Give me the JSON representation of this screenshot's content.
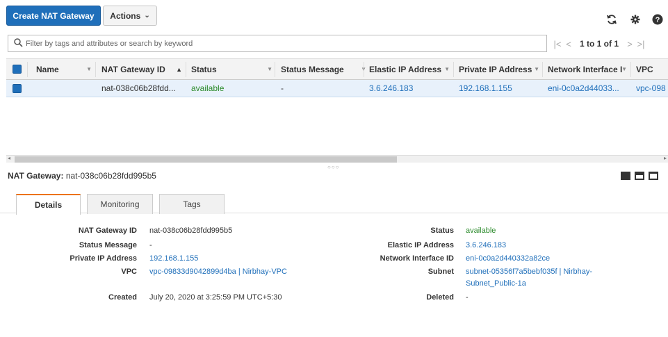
{
  "toolbar": {
    "create_label": "Create NAT Gateway",
    "actions_label": "Actions",
    "actions_chevron": "⌄"
  },
  "search": {
    "placeholder": "Filter by tags and attributes or search by keyword"
  },
  "pager": {
    "text": "1 to 1 of 1",
    "first": "|<",
    "prev": "<",
    "next": ">",
    "last": ">|"
  },
  "table": {
    "columns": [
      "Name",
      "NAT Gateway ID",
      "Status",
      "Status Message",
      "Elastic IP Address",
      "Private IP Address",
      "Network Interface I",
      "VPC"
    ],
    "rows": [
      {
        "name": "",
        "nat_gateway_id": "nat-038c06b28fdd...",
        "status": "available",
        "status_message": "-",
        "elastic_ip": "3.6.246.183",
        "private_ip": "192.168.1.155",
        "network_interface": "eni-0c0a2d44033...",
        "vpc": "vpc-098"
      }
    ]
  },
  "detail": {
    "title_label": "NAT Gateway:",
    "title_value": "nat-038c06b28fdd995b5",
    "tabs": [
      "Details",
      "Monitoring",
      "Tags"
    ],
    "left": [
      {
        "label": "NAT Gateway ID",
        "value": "nat-038c06b28fdd995b5"
      },
      {
        "label": "Status Message",
        "value": "-"
      },
      {
        "label": "Private IP Address",
        "value": "192.168.1.155"
      },
      {
        "label": "VPC",
        "value": "vpc-09833d9042899d4ba | Nirbhay-VPC"
      },
      {
        "label": "Created",
        "value": "July 20, 2020 at 3:25:59 PM UTC+5:30"
      }
    ],
    "right": [
      {
        "label": "Status",
        "value": "available"
      },
      {
        "label": "Elastic IP Address",
        "value": "3.6.246.183"
      },
      {
        "label": "Network Interface ID",
        "value": "eni-0c0a2d440332a82ce"
      },
      {
        "label": "Subnet",
        "value_line1": "subnet-05356f7a5bebf035f | Nirbhay-",
        "value_line2": "Subnet_Public-1a"
      },
      {
        "label": "Deleted",
        "value": "-"
      }
    ]
  },
  "colors": {
    "primary": "#1f6fba",
    "link": "#1f6fba",
    "available": "#2a8a2a",
    "active_tab_accent": "#ec7211",
    "selected_row": "#e8f1fb"
  }
}
